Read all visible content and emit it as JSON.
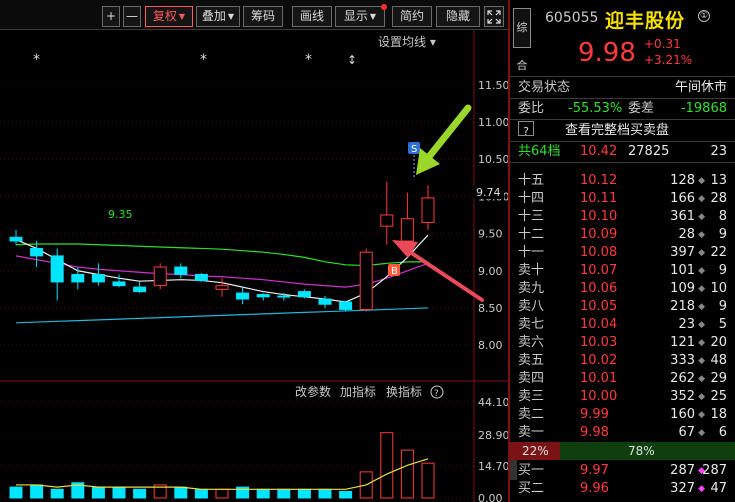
{
  "toolbar": {
    "buttons": [
      {
        "label": "+"
      },
      {
        "label": "—"
      },
      {
        "label": "复权"
      },
      {
        "label": "叠加"
      },
      {
        "label": "筹码"
      },
      {
        "label": "画线"
      },
      {
        "label": "显示"
      },
      {
        "label": "简约"
      },
      {
        "label": "隐藏"
      }
    ],
    "expand_icon": "expand-icon",
    "active_color": "#ff5a5a"
  },
  "chart": {
    "settings_label": "设置均线 ▾",
    "ma_label": "9.35",
    "current_price_label": "9.74",
    "markers": [
      "*",
      "*",
      "*",
      "↕"
    ],
    "signal_sell": "S",
    "signal_buy": "B",
    "price_axis": [
      "11.50",
      "11.00",
      "10.50",
      "10.00",
      "9.50",
      "9.00",
      "8.50",
      "8.00"
    ],
    "indicator_buttons": [
      "改参数",
      "加指标",
      "换指标"
    ],
    "help_icon": "help-icon",
    "volume_axis": [
      "44.10",
      "28.90",
      "14.70",
      "0.00"
    ]
  },
  "chart_data": {
    "type": "candlestick",
    "price_candles": [
      {
        "o": 9.45,
        "h": 9.55,
        "l": 9.35,
        "c": 9.4
      },
      {
        "o": 9.3,
        "h": 9.4,
        "l": 9.05,
        "c": 9.2
      },
      {
        "o": 9.2,
        "h": 9.3,
        "l": 8.6,
        "c": 8.85
      },
      {
        "o": 8.95,
        "h": 9.05,
        "l": 8.75,
        "c": 8.85
      },
      {
        "o": 8.95,
        "h": 9.1,
        "l": 8.8,
        "c": 8.85
      },
      {
        "o": 8.85,
        "h": 8.95,
        "l": 8.78,
        "c": 8.8
      },
      {
        "o": 8.78,
        "h": 8.85,
        "l": 8.7,
        "c": 8.72
      },
      {
        "o": 8.8,
        "h": 9.1,
        "l": 8.75,
        "c": 9.05
      },
      {
        "o": 9.05,
        "h": 9.1,
        "l": 8.9,
        "c": 8.95
      },
      {
        "o": 8.95,
        "h": 8.97,
        "l": 8.85,
        "c": 8.87
      },
      {
        "o": 8.75,
        "h": 8.9,
        "l": 8.65,
        "c": 8.8
      },
      {
        "o": 8.7,
        "h": 8.78,
        "l": 8.55,
        "c": 8.62
      },
      {
        "o": 8.68,
        "h": 8.7,
        "l": 8.6,
        "c": 8.65
      },
      {
        "o": 8.66,
        "h": 8.7,
        "l": 8.6,
        "c": 8.65
      },
      {
        "o": 8.72,
        "h": 8.75,
        "l": 8.63,
        "c": 8.65
      },
      {
        "o": 8.62,
        "h": 8.66,
        "l": 8.5,
        "c": 8.55
      },
      {
        "o": 8.58,
        "h": 8.6,
        "l": 8.45,
        "c": 8.48
      },
      {
        "o": 8.48,
        "h": 9.3,
        "l": 8.45,
        "c": 9.25
      },
      {
        "o": 9.6,
        "h": 10.2,
        "l": 9.35,
        "c": 9.75
      },
      {
        "o": 9.4,
        "h": 10.05,
        "l": 9.2,
        "c": 9.7
      },
      {
        "o": 9.65,
        "h": 10.15,
        "l": 9.55,
        "c": 9.98
      }
    ],
    "ma_short": [
      9.42,
      9.3,
      9.15,
      9.0,
      8.95,
      8.9,
      8.86,
      8.87,
      8.88,
      8.87,
      8.84,
      8.78,
      8.72,
      8.68,
      8.65,
      8.62,
      8.58,
      8.7,
      8.92,
      9.18,
      9.48
    ],
    "ma_mid": [
      9.2,
      9.15,
      9.1,
      9.05,
      9.02,
      9.0,
      8.98,
      8.96,
      8.95,
      8.93,
      8.92,
      8.9,
      8.88,
      8.85,
      8.82,
      8.8,
      8.78,
      8.82,
      8.9,
      9.0,
      9.1
    ],
    "ma_long": [
      9.35,
      9.36,
      9.36,
      9.36,
      9.35,
      9.34,
      9.33,
      9.32,
      9.31,
      9.3,
      9.29,
      9.27,
      9.25,
      9.22,
      9.18,
      9.12,
      9.08,
      9.07,
      9.1,
      9.12,
      9.12
    ],
    "ma_trend": [
      8.3,
      8.31,
      8.32,
      8.33,
      8.34,
      8.35,
      8.36,
      8.37,
      8.38,
      8.39,
      8.4,
      8.41,
      8.42,
      8.43,
      8.44,
      8.45,
      8.46,
      8.47,
      8.48,
      8.49,
      8.5
    ],
    "volume": [
      5,
      6,
      4,
      7,
      5,
      5,
      4,
      6,
      5,
      4,
      4,
      5,
      4,
      4,
      4,
      4,
      3,
      12,
      30,
      22,
      16
    ],
    "volume_ma": [
      6,
      6,
      5,
      6,
      5,
      5,
      5,
      5,
      5,
      4,
      4,
      4,
      4,
      4,
      4,
      4,
      4,
      6,
      11,
      15,
      18
    ],
    "price_ylim": [
      7.8,
      11.7
    ],
    "volume_ylim": [
      0,
      44.1
    ]
  },
  "quote": {
    "tag": "综合",
    "code": "605055",
    "name": "迎丰股份",
    "price": "9.98",
    "change": "+0.31",
    "change_pct": "+3.21%",
    "trade_status_label": "交易状态",
    "trade_status": "午间休市",
    "weibi_label": "委比",
    "weibi": "-55.53%",
    "weicha_label": "委差",
    "weicha": "-19868",
    "full_book_label": "查看完整档买卖盘",
    "total_label": "共64档",
    "total_price": "10.42",
    "total_vol": "27825",
    "total_count": "23"
  },
  "asks": [
    {
      "label": "十五",
      "price": "10.12",
      "vol": "128",
      "cnt": "13"
    },
    {
      "label": "十四",
      "price": "10.11",
      "vol": "166",
      "cnt": "28"
    },
    {
      "label": "十三",
      "price": "10.10",
      "vol": "361",
      "cnt": "8"
    },
    {
      "label": "十二",
      "price": "10.09",
      "vol": "28",
      "cnt": "9"
    },
    {
      "label": "十一",
      "price": "10.08",
      "vol": "397",
      "cnt": "22"
    },
    {
      "label": "卖十",
      "price": "10.07",
      "vol": "101",
      "cnt": "9"
    },
    {
      "label": "卖九",
      "price": "10.06",
      "vol": "109",
      "cnt": "10"
    },
    {
      "label": "卖八",
      "price": "10.05",
      "vol": "218",
      "cnt": "9"
    },
    {
      "label": "卖七",
      "price": "10.04",
      "vol": "23",
      "cnt": "5"
    },
    {
      "label": "卖六",
      "price": "10.03",
      "vol": "121",
      "cnt": "20"
    },
    {
      "label": "卖五",
      "price": "10.02",
      "vol": "333",
      "cnt": "48"
    },
    {
      "label": "卖四",
      "price": "10.01",
      "vol": "262",
      "cnt": "29"
    },
    {
      "label": "卖三",
      "price": "10.00",
      "vol": "352",
      "cnt": "25"
    },
    {
      "label": "卖二",
      "price": "9.99",
      "vol": "160",
      "cnt": "18"
    },
    {
      "label": "卖一",
      "price": "9.98",
      "vol": "67",
      "cnt": "6"
    }
  ],
  "ratio": {
    "sell": "22%",
    "buy": "78%"
  },
  "bids": [
    {
      "label": "买一",
      "price": "9.97",
      "vol": "287",
      "cnt": "287"
    },
    {
      "label": "买二",
      "price": "9.96",
      "vol": "327",
      "cnt": "47"
    }
  ],
  "colors": {
    "up": "#ff3b3b",
    "down": "#00e5ff",
    "name": "#f5e000",
    "flat": "#2ee02e"
  }
}
